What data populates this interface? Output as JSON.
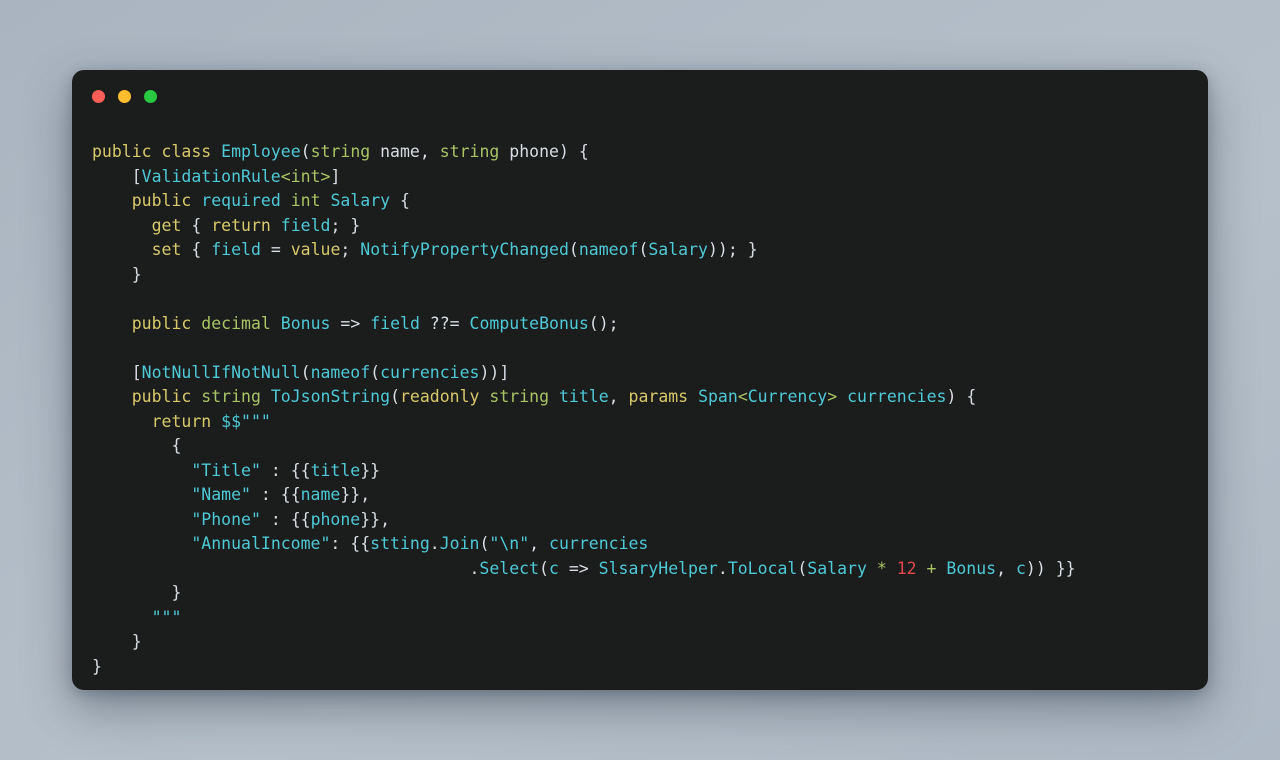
{
  "window": {
    "traffic_lights": [
      {
        "name": "close",
        "color": "#ff5f57"
      },
      {
        "name": "minimize",
        "color": "#febc2e"
      },
      {
        "name": "maximize",
        "color": "#28c840"
      }
    ],
    "background_color": "#1b1c1c",
    "page_background_color": "#b2bcc7"
  },
  "theme": {
    "keyword": "#d8c96a",
    "builtin_type": "#a8c465",
    "identifier": "#4ec9d6",
    "plain": "#d8dee4",
    "string": "#4ec9d6",
    "number": "#e0474c",
    "operator": "#a8c465"
  },
  "code": {
    "language": "csharp",
    "plain_text": "public class Employee(string name, string phone) {\n    [ValidationRule<int>]\n    public required int Salary {\n      get { return field; }\n      set { field = value; NotifyPropertyChanged(nameof(Salary)); }\n    }\n\n    public decimal Bonus => field ??= ComputeBonus();\n\n    [NotNullIfNotNull(nameof(currencies))]\n    public string ToJsonString(readonly string title, params Span<Currency> currencies) {\n      return $$\"\"\"\n        {\n          \"Title\" : {{title}}\n          \"Name\" : {{name}},\n          \"Phone\" : {{phone}},\n          \"AnnualIncome\": {{stting.Join(\"\\n\", currencies\n                                      .Select(c => SlsaryHelper.ToLocal(Salary * 12 + Bonus, c)) }}\n        }\n      \"\"\"\n    }\n}",
    "lines": [
      {
        "n": 1,
        "tokens": [
          {
            "t": "public",
            "c": "kw"
          },
          {
            "t": " ",
            "c": "pl"
          },
          {
            "t": "class",
            "c": "kw"
          },
          {
            "t": " ",
            "c": "pl"
          },
          {
            "t": "Employee",
            "c": "id"
          },
          {
            "t": "(",
            "c": "pl"
          },
          {
            "t": "string",
            "c": "typ"
          },
          {
            "t": " ",
            "c": "pl"
          },
          {
            "t": "name",
            "c": "var"
          },
          {
            "t": ", ",
            "c": "pl"
          },
          {
            "t": "string",
            "c": "typ"
          },
          {
            "t": " ",
            "c": "pl"
          },
          {
            "t": "phone",
            "c": "var"
          },
          {
            "t": ") {",
            "c": "pl"
          }
        ]
      },
      {
        "n": 2,
        "tokens": [
          {
            "t": "    [",
            "c": "pl"
          },
          {
            "t": "ValidationRule",
            "c": "id"
          },
          {
            "t": "<",
            "c": "typ"
          },
          {
            "t": "int",
            "c": "typ"
          },
          {
            "t": ">",
            "c": "typ"
          },
          {
            "t": "]",
            "c": "pl"
          }
        ]
      },
      {
        "n": 3,
        "tokens": [
          {
            "t": "    ",
            "c": "pl"
          },
          {
            "t": "public",
            "c": "kw"
          },
          {
            "t": " ",
            "c": "pl"
          },
          {
            "t": "required",
            "c": "id"
          },
          {
            "t": " ",
            "c": "pl"
          },
          {
            "t": "int",
            "c": "typ"
          },
          {
            "t": " ",
            "c": "pl"
          },
          {
            "t": "Salary",
            "c": "id"
          },
          {
            "t": " {",
            "c": "pl"
          }
        ]
      },
      {
        "n": 4,
        "tokens": [
          {
            "t": "      ",
            "c": "pl"
          },
          {
            "t": "get",
            "c": "kw"
          },
          {
            "t": " { ",
            "c": "pl"
          },
          {
            "t": "return",
            "c": "kw"
          },
          {
            "t": " ",
            "c": "pl"
          },
          {
            "t": "field",
            "c": "id"
          },
          {
            "t": "; }",
            "c": "pl"
          }
        ]
      },
      {
        "n": 5,
        "tokens": [
          {
            "t": "      ",
            "c": "pl"
          },
          {
            "t": "set",
            "c": "kw"
          },
          {
            "t": " { ",
            "c": "pl"
          },
          {
            "t": "field",
            "c": "id"
          },
          {
            "t": " = ",
            "c": "pl"
          },
          {
            "t": "value",
            "c": "kw"
          },
          {
            "t": "; ",
            "c": "pl"
          },
          {
            "t": "NotifyPropertyChanged",
            "c": "id"
          },
          {
            "t": "(",
            "c": "pl"
          },
          {
            "t": "nameof",
            "c": "id"
          },
          {
            "t": "(",
            "c": "pl"
          },
          {
            "t": "Salary",
            "c": "id"
          },
          {
            "t": ")); }",
            "c": "pl"
          }
        ]
      },
      {
        "n": 6,
        "tokens": [
          {
            "t": "    }",
            "c": "pl"
          }
        ]
      },
      {
        "n": 7,
        "tokens": [
          {
            "t": "",
            "c": "pl"
          }
        ]
      },
      {
        "n": 8,
        "tokens": [
          {
            "t": "    ",
            "c": "pl"
          },
          {
            "t": "public",
            "c": "kw"
          },
          {
            "t": " ",
            "c": "pl"
          },
          {
            "t": "decimal",
            "c": "typ"
          },
          {
            "t": " ",
            "c": "pl"
          },
          {
            "t": "Bonus",
            "c": "id"
          },
          {
            "t": " => ",
            "c": "pl"
          },
          {
            "t": "field",
            "c": "id"
          },
          {
            "t": " ??= ",
            "c": "pl"
          },
          {
            "t": "ComputeBonus",
            "c": "id"
          },
          {
            "t": "();",
            "c": "pl"
          }
        ]
      },
      {
        "n": 9,
        "tokens": [
          {
            "t": "",
            "c": "pl"
          }
        ]
      },
      {
        "n": 10,
        "tokens": [
          {
            "t": "    [",
            "c": "pl"
          },
          {
            "t": "NotNullIfNotNull",
            "c": "id"
          },
          {
            "t": "(",
            "c": "pl"
          },
          {
            "t": "nameof",
            "c": "id"
          },
          {
            "t": "(",
            "c": "pl"
          },
          {
            "t": "currencies",
            "c": "id"
          },
          {
            "t": "))]",
            "c": "pl"
          }
        ]
      },
      {
        "n": 11,
        "tokens": [
          {
            "t": "    ",
            "c": "pl"
          },
          {
            "t": "public",
            "c": "kw"
          },
          {
            "t": " ",
            "c": "pl"
          },
          {
            "t": "string",
            "c": "typ"
          },
          {
            "t": " ",
            "c": "pl"
          },
          {
            "t": "ToJsonString",
            "c": "id"
          },
          {
            "t": "(",
            "c": "pl"
          },
          {
            "t": "readonly",
            "c": "kw"
          },
          {
            "t": " ",
            "c": "pl"
          },
          {
            "t": "string",
            "c": "typ"
          },
          {
            "t": " ",
            "c": "pl"
          },
          {
            "t": "title",
            "c": "id"
          },
          {
            "t": ", ",
            "c": "pl"
          },
          {
            "t": "params",
            "c": "kw"
          },
          {
            "t": " ",
            "c": "pl"
          },
          {
            "t": "Span",
            "c": "id"
          },
          {
            "t": "<",
            "c": "typ"
          },
          {
            "t": "Currency",
            "c": "id"
          },
          {
            "t": ">",
            "c": "typ"
          },
          {
            "t": " ",
            "c": "pl"
          },
          {
            "t": "currencies",
            "c": "id"
          },
          {
            "t": ") {",
            "c": "pl"
          }
        ]
      },
      {
        "n": 12,
        "tokens": [
          {
            "t": "      ",
            "c": "pl"
          },
          {
            "t": "return",
            "c": "kw"
          },
          {
            "t": " ",
            "c": "pl"
          },
          {
            "t": "$$",
            "c": "id"
          },
          {
            "t": "\"\"\"",
            "c": "str"
          }
        ]
      },
      {
        "n": 13,
        "tokens": [
          {
            "t": "        {",
            "c": "pl"
          }
        ]
      },
      {
        "n": 14,
        "tokens": [
          {
            "t": "          ",
            "c": "pl"
          },
          {
            "t": "\"Title\"",
            "c": "str"
          },
          {
            "t": " : {{",
            "c": "pl"
          },
          {
            "t": "title",
            "c": "id"
          },
          {
            "t": "}}",
            "c": "pl"
          }
        ]
      },
      {
        "n": 15,
        "tokens": [
          {
            "t": "          ",
            "c": "pl"
          },
          {
            "t": "\"Name\"",
            "c": "str"
          },
          {
            "t": " : {{",
            "c": "pl"
          },
          {
            "t": "name",
            "c": "id"
          },
          {
            "t": "}},",
            "c": "pl"
          }
        ]
      },
      {
        "n": 16,
        "tokens": [
          {
            "t": "          ",
            "c": "pl"
          },
          {
            "t": "\"Phone\"",
            "c": "str"
          },
          {
            "t": " : {{",
            "c": "pl"
          },
          {
            "t": "phone",
            "c": "id"
          },
          {
            "t": "}},",
            "c": "pl"
          }
        ]
      },
      {
        "n": 17,
        "tokens": [
          {
            "t": "          ",
            "c": "pl"
          },
          {
            "t": "\"AnnualIncome\"",
            "c": "str"
          },
          {
            "t": ": {{",
            "c": "pl"
          },
          {
            "t": "stting",
            "c": "id"
          },
          {
            "t": ".",
            "c": "pl"
          },
          {
            "t": "Join",
            "c": "id"
          },
          {
            "t": "(",
            "c": "pl"
          },
          {
            "t": "\"\\n\"",
            "c": "str"
          },
          {
            "t": ", ",
            "c": "pl"
          },
          {
            "t": "currencies",
            "c": "id"
          }
        ]
      },
      {
        "n": 18,
        "tokens": [
          {
            "t": "                                      .",
            "c": "pl"
          },
          {
            "t": "Select",
            "c": "id"
          },
          {
            "t": "(",
            "c": "pl"
          },
          {
            "t": "c",
            "c": "id"
          },
          {
            "t": " => ",
            "c": "pl"
          },
          {
            "t": "SlsaryHelper",
            "c": "id"
          },
          {
            "t": ".",
            "c": "pl"
          },
          {
            "t": "ToLocal",
            "c": "id"
          },
          {
            "t": "(",
            "c": "pl"
          },
          {
            "t": "Salary",
            "c": "id"
          },
          {
            "t": " ",
            "c": "pl"
          },
          {
            "t": "*",
            "c": "op"
          },
          {
            "t": " ",
            "c": "pl"
          },
          {
            "t": "12",
            "c": "num"
          },
          {
            "t": " ",
            "c": "pl"
          },
          {
            "t": "+",
            "c": "op"
          },
          {
            "t": " ",
            "c": "pl"
          },
          {
            "t": "Bonus",
            "c": "id"
          },
          {
            "t": ", ",
            "c": "pl"
          },
          {
            "t": "c",
            "c": "id"
          },
          {
            "t": ")) }}",
            "c": "pl"
          }
        ]
      },
      {
        "n": 19,
        "tokens": [
          {
            "t": "        }",
            "c": "pl"
          }
        ]
      },
      {
        "n": 20,
        "tokens": [
          {
            "t": "      ",
            "c": "pl"
          },
          {
            "t": "\"\"\"",
            "c": "str"
          }
        ]
      },
      {
        "n": 21,
        "tokens": [
          {
            "t": "    }",
            "c": "pl"
          }
        ]
      },
      {
        "n": 22,
        "tokens": [
          {
            "t": "}",
            "c": "pl"
          }
        ]
      }
    ]
  }
}
